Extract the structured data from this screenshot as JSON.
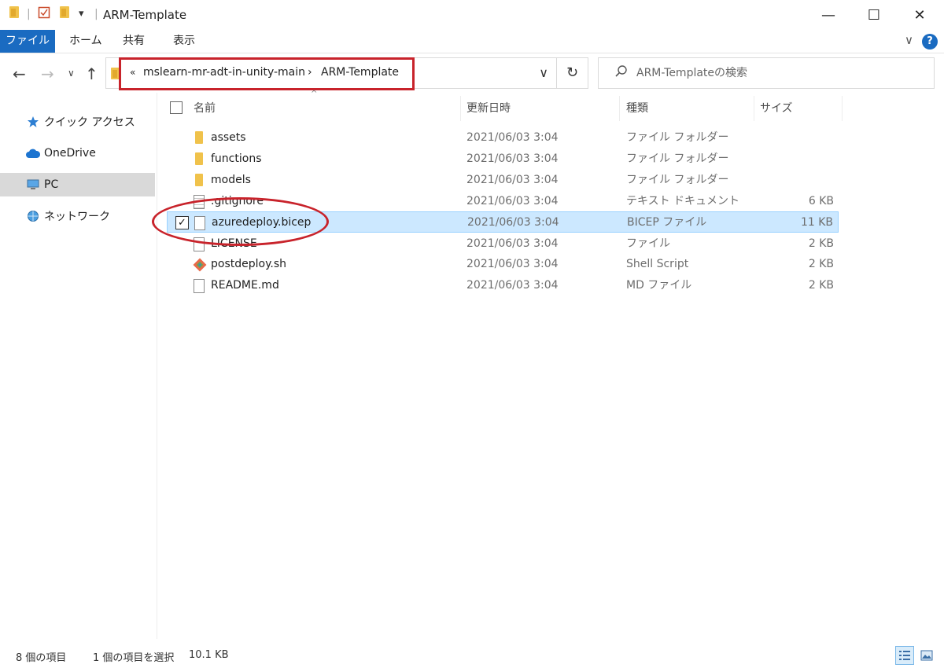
{
  "window": {
    "title": "ARM-Template",
    "minimize": "—",
    "maximize": "☐",
    "close": "✕"
  },
  "quick_access": {
    "dropdown": "▾",
    "separator": "|"
  },
  "ribbon": {
    "tabs": [
      "ファイル",
      "ホーム",
      "共有",
      "表示"
    ],
    "expand": "∨",
    "help": "?"
  },
  "nav": {
    "back": "←",
    "forward": "→",
    "recent": "∨",
    "up": "↑",
    "refresh": "↻",
    "address": {
      "overflow": "«",
      "segments": [
        "mslearn-mr-adt-in-unity-main",
        "ARM-Template"
      ],
      "separator": "›",
      "dropdown": "∨"
    },
    "search": {
      "placeholder": "ARM-Templateの検索",
      "icon": "search-icon"
    }
  },
  "sidebar": {
    "items": [
      {
        "label": "クイック アクセス",
        "icon": "star-icon",
        "selected": false
      },
      {
        "label": "OneDrive",
        "icon": "cloud-icon",
        "selected": false
      },
      {
        "label": "PC",
        "icon": "computer-icon",
        "selected": true
      },
      {
        "label": "ネットワーク",
        "icon": "network-icon",
        "selected": false
      }
    ]
  },
  "columns": {
    "name": "名前",
    "date": "更新日時",
    "type": "種類",
    "size": "サイズ",
    "sort_indicator": "^"
  },
  "files": [
    {
      "name": "assets",
      "date": "2021/06/03 3:04",
      "type": "ファイル フォルダー",
      "size": "",
      "icon": "folder-icon",
      "selected": false
    },
    {
      "name": "functions",
      "date": "2021/06/03 3:04",
      "type": "ファイル フォルダー",
      "size": "",
      "icon": "folder-icon",
      "selected": false
    },
    {
      "name": "models",
      "date": "2021/06/03 3:04",
      "type": "ファイル フォルダー",
      "size": "",
      "icon": "folder-icon",
      "selected": false
    },
    {
      "name": ".gitignore",
      "date": "2021/06/03 3:04",
      "type": "テキスト ドキュメント",
      "size": "6 KB",
      "icon": "text-file-icon",
      "selected": false
    },
    {
      "name": "azuredeploy.bicep",
      "date": "2021/06/03 3:04",
      "type": "BICEP ファイル",
      "size": "11 KB",
      "icon": "file-icon",
      "selected": true
    },
    {
      "name": "LICENSE",
      "date": "2021/06/03 3:04",
      "type": "ファイル",
      "size": "2 KB",
      "icon": "file-icon",
      "selected": false
    },
    {
      "name": "postdeploy.sh",
      "date": "2021/06/03 3:04",
      "type": "Shell Script",
      "size": "2 KB",
      "icon": "git-icon",
      "selected": false
    },
    {
      "name": "README.md",
      "date": "2021/06/03 3:04",
      "type": "MD ファイル",
      "size": "2 KB",
      "icon": "file-icon",
      "selected": false
    }
  ],
  "status": {
    "item_count": "8 個の項目",
    "selection": "1 個の項目を選択",
    "selection_size": "10.1 KB"
  },
  "colors": {
    "accent": "#1a6bc1",
    "annotation": "#c8232b",
    "selection": "#cce8ff"
  }
}
